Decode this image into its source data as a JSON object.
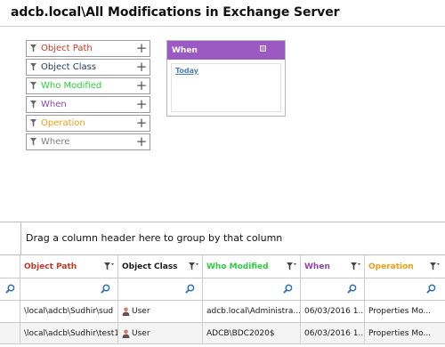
{
  "page_title": "adcb.local\\All Modifications in Exchange Server",
  "filters": [
    {
      "label": "Object Path",
      "color": "#c0392b"
    },
    {
      "label": "Object Class",
      "color": "#1e3a5c"
    },
    {
      "label": "Who Modified",
      "color": "#2ecc40"
    },
    {
      "label": "When",
      "color": "#8e44ad"
    },
    {
      "label": "Operation",
      "color": "#f39c12"
    },
    {
      "label": "Where",
      "color": "#7f7f7f"
    }
  ],
  "when_panel": {
    "title": "When",
    "option": "Today",
    "header_color": "#9b59c2"
  },
  "grid": {
    "group_hint": "Drag a column header here to group by that column",
    "columns": [
      {
        "label": "Object Path",
        "color": "#c0392b"
      },
      {
        "label": "Object Class",
        "color": "#1a1a1a"
      },
      {
        "label": "Who Modified",
        "color": "#2ecc40"
      },
      {
        "label": "When",
        "color": "#8e44ad"
      },
      {
        "label": "Operation",
        "color": "#f39c12"
      }
    ],
    "rows": [
      {
        "object_path": "\\local\\adcb\\Sudhir\\sud",
        "object_class": "User",
        "who_modified": "adcb.local\\Administra...",
        "when": "06/03/2016 1...",
        "operation": "Properties Mo..."
      },
      {
        "object_path": "\\local\\adcb\\Sudhir\\test1",
        "object_class": "User",
        "who_modified": "ADCB\\BDC2020$",
        "when": "06/03/2016 1...",
        "operation": "Properties Mo..."
      }
    ]
  }
}
